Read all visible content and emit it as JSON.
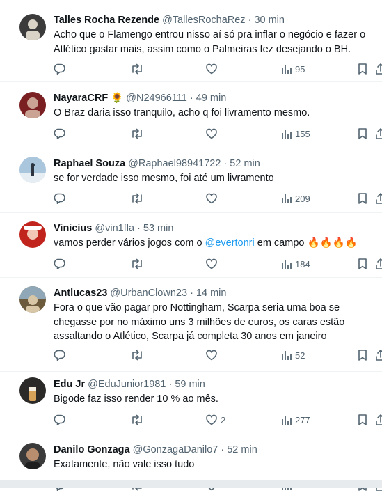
{
  "tweets": [
    {
      "name": "Talles Rocha Rezende",
      "handle": "@TallesRochaRez",
      "time": "· 30 min",
      "text": "Acho que o Flamengo entrou nisso aí só pra inflar o negócio e fazer o Atlético gastar mais, assim como o Palmeiras fez desejando o BH.",
      "likes": "",
      "views": "95",
      "avatar_colors": [
        "#3b3b3b",
        "#d9d2c6"
      ]
    },
    {
      "name": "NayaraCRF",
      "emoji": "🌻",
      "handle": "@N24966111",
      "time": "· 49 min",
      "text": "O Braz daria isso tranquilo, acho q foi livramento mesmo.",
      "likes": "",
      "views": "155",
      "avatar_colors": [
        "#7a1f22",
        "#caa394"
      ]
    },
    {
      "name": "Raphael Souza",
      "handle": "@Raphael98941722",
      "time": "· 52 min",
      "text": "se for verdade isso mesmo, foi até um livramento",
      "likes": "",
      "views": "209",
      "avatar_colors": [
        "#a9c6dd",
        "#e6eef4"
      ]
    },
    {
      "name": "Vinicius",
      "handle": "@vin1fla",
      "time": "· 53 min",
      "text_before": "vamos perder vários jogos com o ",
      "mention": "@evertonri",
      "text_after": " em campo 🔥🔥🔥🔥",
      "likes": "",
      "views": "184",
      "avatar_colors": [
        "#c0241c",
        "#f2c7b5"
      ]
    },
    {
      "name": "Antlucas23",
      "handle": "@UrbanClown23",
      "time": "· 14 min",
      "text": "Fora o que vão pagar pro Nottingham, Scarpa seria uma boa se chegasse por no máximo uns 3 milhões de euros, os caras estão assaltando o Atlético, Scarpa já completa 30 anos em janeiro",
      "likes": "",
      "views": "52",
      "avatar_colors": [
        "#6b5a3b",
        "#d8c7a6"
      ]
    },
    {
      "name": "Edu Jr",
      "handle": "@EduJunior1981",
      "time": "· 59 min",
      "text": "Bigode faz isso render 10 % ao mês.",
      "likes": "2",
      "views": "277",
      "avatar_colors": [
        "#2c2a28",
        "#d6a25a"
      ]
    },
    {
      "name": "Danilo Gonzaga",
      "handle": "@GonzagaDanilo7",
      "time": "· 52 min",
      "text": "Exatamente, não vale isso tudo",
      "likes": "",
      "views": "",
      "avatar_colors": [
        "#3a3a3a",
        "#b98e6e"
      ]
    }
  ],
  "icons": [
    "reply-icon",
    "retweet-icon",
    "like-icon",
    "views-icon",
    "bookmark-icon",
    "share-icon"
  ],
  "colors": {
    "icon": "#536471",
    "mention": "#1d9bf0",
    "text": "#0f1419",
    "meta": "#536471"
  }
}
